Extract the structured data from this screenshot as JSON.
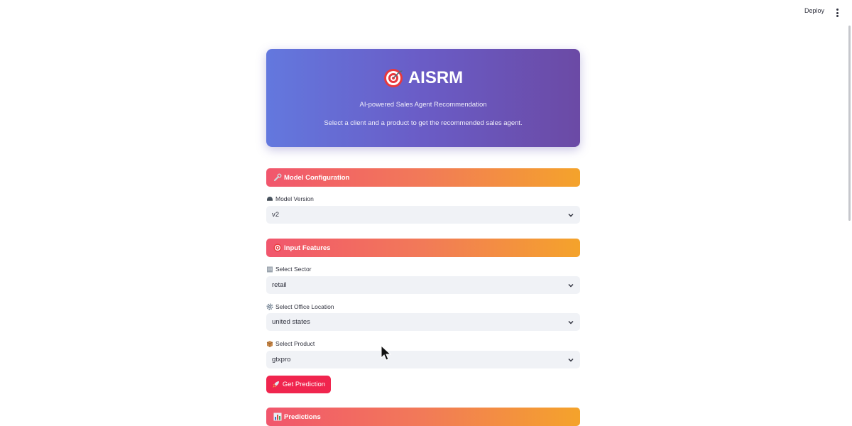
{
  "topbar": {
    "deploy_label": "Deploy"
  },
  "hero": {
    "title": "AISRM",
    "subtitle": "AI-powered Sales Agent Recommendation",
    "description": "Select a client and a product to get the recommended sales agent."
  },
  "sections": {
    "model_config": "Model Configuration",
    "input_features": "Input Features",
    "predictions": "Predictions"
  },
  "fields": {
    "model_version": {
      "label": "Model Version",
      "value": "v2"
    },
    "sector": {
      "label": "Select Sector",
      "value": "retail"
    },
    "office_location": {
      "label": "Select Office Location",
      "value": "united states"
    },
    "product": {
      "label": "Select Product",
      "value": "gtxpro"
    }
  },
  "buttons": {
    "predict_label": "Get Prediction"
  },
  "colors": {
    "hero_start": "#6378de",
    "hero_end": "#6b4aa5",
    "section_start": "#f1566d",
    "section_end": "#f4a32b",
    "primary_button": "#f0254e"
  },
  "icons": {
    "hero": "target-icon",
    "model_config": "wrench-icon",
    "input_features": "target-icon",
    "predictions": "bar-chart-icon",
    "model_version": "helmet-icon",
    "sector": "building-icon",
    "office_location": "gear-icon",
    "product": "package-icon",
    "predict_button": "rocket-icon"
  }
}
